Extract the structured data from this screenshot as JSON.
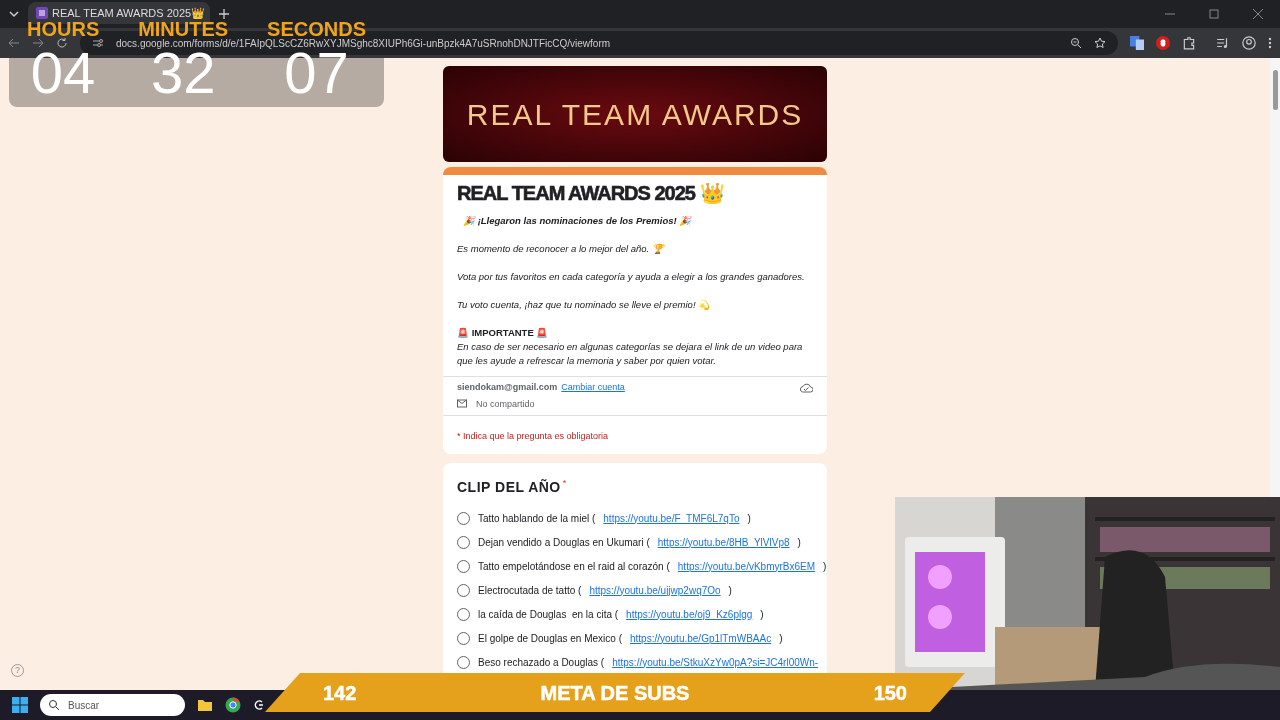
{
  "browser": {
    "tab": {
      "title": "REAL TEAM AWARDS 2025👑",
      "selected": true
    },
    "url": "docs.google.com/forms/d/e/1FAIpQLScCZ6RwXYJMSghc8XIUPh6Gi-unBpzk4A7uSRnohDNJTFicCQ/viewform"
  },
  "timer": [
    {
      "label": "HOURS",
      "value": "04"
    },
    {
      "label": "MINUTES",
      "value": "32"
    },
    {
      "label": "SECONDS",
      "value": "07"
    }
  ],
  "form": {
    "banner": "REAL TEAM AWARDS",
    "title": "REAL TEAM AWARDS 2025 👑",
    "description": [
      {
        "kind": "bold",
        "text": "🎉 ¡Llegaron las nominaciones de los Premios! 🎉"
      },
      {
        "kind": "italic",
        "text": "Es momento de reconocer a lo mejor del año. 🏆"
      },
      {
        "kind": "italic",
        "text": "Vota por tus favoritos en cada categoría y ayuda a elegir a los grandes ganadores."
      },
      {
        "kind": "italic",
        "text": "Tu voto cuenta, ¡haz que tu nominado se lleve el premio! 💫"
      },
      {
        "kind": "heading",
        "text": "🚨 IMPORTANTE 🚨"
      },
      {
        "kind": "note",
        "text": "En caso de ser necesario en algunas categorías se dejara el link de un video para que les ayude a refrescar la memoria y saber por quien votar."
      }
    ],
    "account": "siendokam@gmail.com",
    "switch_account": "Cambiar cuenta",
    "sharing": "No compartido",
    "required_note": "* Indica que la pregunta es obligatoria"
  },
  "question": {
    "title": "CLIP DEL AÑO",
    "required_mark": "*",
    "options": [
      {
        "label": "Tatto hablando de la miel (",
        "link": "https://youtu.be/F_TMF6L7qTo",
        "after": ")",
        "selected": false
      },
      {
        "label": "Dejan vendido a Douglas en Ukumari (",
        "link": "https://youtu.be/8HB_YlVlVp8",
        "after": ")",
        "selected": false
      },
      {
        "label": "Tatto empelotándose en el raid al corazón (",
        "link": "https://youtu.be/vKbmyrBx6EM",
        "after": ")",
        "selected": false
      },
      {
        "label": "Electrocutada de tatto (",
        "link": "https://youtu.be/ujjwp2wq7Oo",
        "after": ")",
        "selected": false
      },
      {
        "label": "la caída de Douglas  en la cita (",
        "link": "https://youtu.be/oj9_Kz6plgg",
        "after": ")",
        "selected": false
      },
      {
        "label": "El golpe de Douglas en Mexico (",
        "link": "https://youtu.be/Gp1lTmWBAAc",
        "after": ")",
        "selected": false
      },
      {
        "label": "Beso rechazado a Douglas (",
        "link": "https://youtu.be/StkuXzYw0pA?si=JC4rl00Wn-",
        "selected": false
      }
    ]
  },
  "help": "?",
  "sub_goal": {
    "current": "142",
    "label": "META DE SUBS",
    "target": "150"
  },
  "taskbar": {
    "search_placeholder": "Buscar"
  }
}
